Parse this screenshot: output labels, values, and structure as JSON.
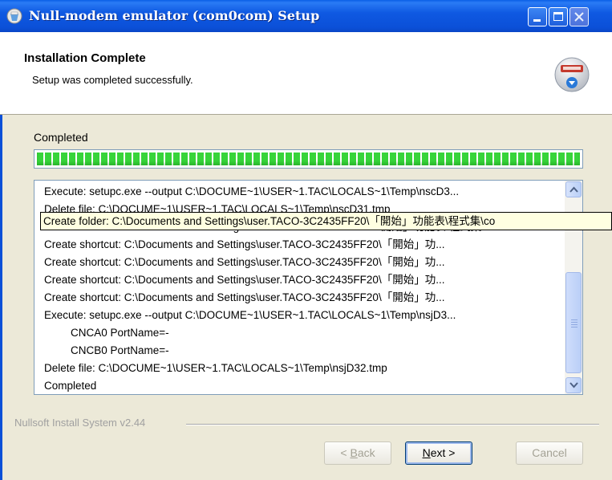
{
  "window": {
    "title": "Null-modem emulator (com0com) Setup"
  },
  "header": {
    "title": "Installation Complete",
    "subtitle": "Setup was completed successfully."
  },
  "status": {
    "label": "Completed",
    "progress_percent": 100
  },
  "log": {
    "lines": [
      {
        "text": "Execute: setupc.exe  --output C:\\DOCUME~1\\USER~1.TAC\\LOCALS~1\\Temp\\nscD3..."
      },
      {
        "text": "Delete file: C:\\DOCUME~1\\USER~1.TAC\\LOCALS~1\\Temp\\nscD31.tmp"
      },
      {
        "text": "Create folder: C:\\Documents and Settings\\user.TACO-3C2435FF20\\「開始」功能表\\程式集\\co"
      },
      {
        "text": "Create shortcut: C:\\Documents and Settings\\user.TACO-3C2435FF20\\「開始」功..."
      },
      {
        "text": "Create shortcut: C:\\Documents and Settings\\user.TACO-3C2435FF20\\「開始」功..."
      },
      {
        "text": "Create shortcut: C:\\Documents and Settings\\user.TACO-3C2435FF20\\「開始」功..."
      },
      {
        "text": "Create shortcut: C:\\Documents and Settings\\user.TACO-3C2435FF20\\「開始」功..."
      },
      {
        "text": "Execute: setupc.exe  --output C:\\DOCUME~1\\USER~1.TAC\\LOCALS~1\\Temp\\nsjD3..."
      },
      {
        "text": "CNCA0 PortName=-"
      },
      {
        "text": "CNCB0 PortName=-"
      },
      {
        "text": "Delete file: C:\\DOCUME~1\\USER~1.TAC\\LOCALS~1\\Temp\\nsjD32.tmp"
      },
      {
        "text": "Completed"
      }
    ],
    "tooltip": "Create folder: C:\\Documents and Settings\\user.TACO-3C2435FF20\\「開始」功能表\\程式集\\co"
  },
  "footer": {
    "brand": "Nullsoft Install System v2.44"
  },
  "buttons": {
    "back_prefix": "< ",
    "back_key": "B",
    "back_rest": "ack",
    "next_key": "N",
    "next_rest": "ext >",
    "cancel": "Cancel"
  },
  "icons": {
    "app": "installer-app-icon",
    "header": "installer-disk-icon",
    "scroll_up": "chevron-up-icon",
    "scroll_down": "chevron-down-icon"
  },
  "colors": {
    "titlebar": "#0B50D8",
    "progress": "#37D43A",
    "tooltip_bg": "#FFFFE1"
  }
}
